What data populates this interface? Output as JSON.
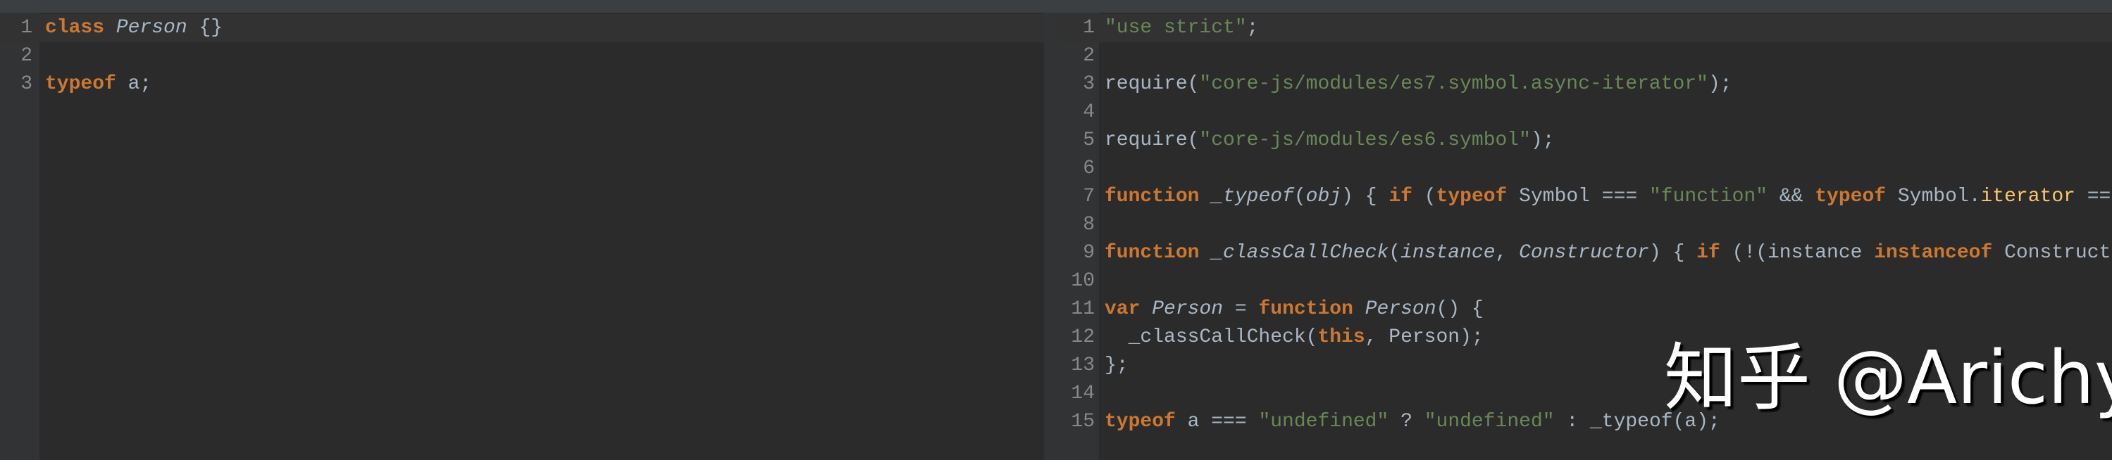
{
  "colors": {
    "background": "#2b2b2b",
    "gutter": "#313335",
    "keyword": "#cc7832",
    "string": "#6a8759",
    "text": "#a9b7c6",
    "field": "#ffc66d"
  },
  "left_editor": {
    "lines": [
      {
        "n": "1",
        "tokens": [
          [
            "k",
            "class"
          ],
          [
            "t",
            " "
          ],
          [
            "i",
            "Person"
          ],
          [
            "t",
            " {}"
          ]
        ]
      },
      {
        "n": "2",
        "tokens": []
      },
      {
        "n": "3",
        "tokens": [
          [
            "k",
            "typeof"
          ],
          [
            "t",
            " a;"
          ]
        ]
      }
    ]
  },
  "right_editor": {
    "lines": [
      {
        "n": "1",
        "tokens": [
          [
            "s",
            "\"use strict\""
          ],
          [
            "t",
            ";"
          ]
        ]
      },
      {
        "n": "2",
        "tokens": []
      },
      {
        "n": "3",
        "tokens": [
          [
            "t",
            "require("
          ],
          [
            "s",
            "\"core-js/modules/es7.symbol.async-iterator\""
          ],
          [
            "t",
            ");"
          ]
        ]
      },
      {
        "n": "4",
        "tokens": []
      },
      {
        "n": "5",
        "tokens": [
          [
            "t",
            "require("
          ],
          [
            "s",
            "\"core-js/modules/es6.symbol\""
          ],
          [
            "t",
            ");"
          ]
        ]
      },
      {
        "n": "6",
        "tokens": []
      },
      {
        "n": "7",
        "tokens": [
          [
            "k",
            "function"
          ],
          [
            "t",
            " "
          ],
          [
            "i",
            "_typeof"
          ],
          [
            "t",
            "("
          ],
          [
            "i",
            "obj"
          ],
          [
            "t",
            ") { "
          ],
          [
            "k",
            "if"
          ],
          [
            "t",
            " ("
          ],
          [
            "k",
            "typeof"
          ],
          [
            "t",
            " Symbol === "
          ],
          [
            "s",
            "\"function\""
          ],
          [
            "t",
            " && "
          ],
          [
            "k",
            "typeof"
          ],
          [
            "t",
            " Symbol."
          ],
          [
            "f",
            "iterator"
          ],
          [
            "t",
            " =="
          ]
        ]
      },
      {
        "n": "8",
        "tokens": []
      },
      {
        "n": "9",
        "tokens": [
          [
            "k",
            "function"
          ],
          [
            "t",
            " "
          ],
          [
            "i",
            "_classCallCheck"
          ],
          [
            "t",
            "("
          ],
          [
            "i",
            "instance"
          ],
          [
            "t",
            ", "
          ],
          [
            "i",
            "Constructor"
          ],
          [
            "t",
            ") { "
          ],
          [
            "k",
            "if"
          ],
          [
            "t",
            " (!(instance "
          ],
          [
            "k",
            "instanceof"
          ],
          [
            "t",
            " Construct"
          ]
        ]
      },
      {
        "n": "10",
        "tokens": []
      },
      {
        "n": "11",
        "tokens": [
          [
            "k",
            "var"
          ],
          [
            "t",
            " "
          ],
          [
            "i",
            "Person"
          ],
          [
            "t",
            " = "
          ],
          [
            "k",
            "function"
          ],
          [
            "t",
            " "
          ],
          [
            "i",
            "Person"
          ],
          [
            "t",
            "() {"
          ]
        ]
      },
      {
        "n": "12",
        "tokens": [
          [
            "t",
            "  _classCallCheck("
          ],
          [
            "k",
            "this"
          ],
          [
            "t",
            ", Person);"
          ]
        ]
      },
      {
        "n": "13",
        "tokens": [
          [
            "t",
            "};"
          ]
        ]
      },
      {
        "n": "14",
        "tokens": []
      },
      {
        "n": "15",
        "tokens": [
          [
            "k",
            "typeof"
          ],
          [
            "t",
            " a === "
          ],
          [
            "s",
            "\"undefined\""
          ],
          [
            "t",
            " ? "
          ],
          [
            "s",
            "\"undefined\""
          ],
          [
            "t",
            " : _typeof(a);"
          ]
        ]
      }
    ]
  },
  "watermark": "知乎 @Arichy"
}
